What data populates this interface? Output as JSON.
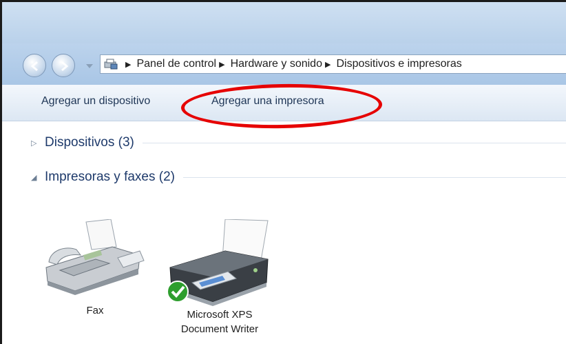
{
  "breadcrumb": {
    "items": [
      "Panel de control",
      "Hardware y sonido",
      "Dispositivos e impresoras"
    ]
  },
  "toolbar": {
    "add_device_label": "Agregar un dispositivo",
    "add_printer_label": "Agregar una impresora"
  },
  "groups": {
    "devices": {
      "label": "Dispositivos (3)",
      "expanded": false
    },
    "printers": {
      "label": "Impresoras y faxes (2)",
      "expanded": true
    }
  },
  "printers": [
    {
      "label": "Fax",
      "icon": "fax-icon",
      "is_default": false
    },
    {
      "label_line1": "Microsoft XPS",
      "label_line2": "Document Writer",
      "icon": "printer-icon",
      "is_default": true
    }
  ],
  "colors": {
    "highlight": "#e60000",
    "group_header_text": "#1e3a6b",
    "toolbar_text": "#1e3555",
    "default_check": "#2e9e2e"
  },
  "icons": {
    "back": "back-arrow-icon",
    "forward": "forward-arrow-icon",
    "address": "devices-printers-icon",
    "collapsed_caret": "caret-right-icon",
    "expanded_caret": "caret-down-icon",
    "default_check": "checkmark-icon"
  }
}
